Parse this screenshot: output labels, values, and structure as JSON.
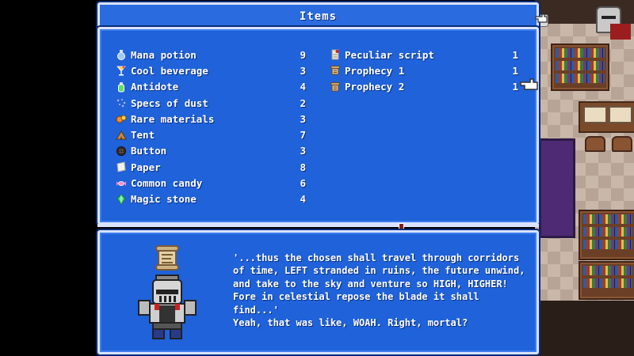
{
  "window": {
    "title": "Items"
  },
  "items_left": [
    {
      "name": "Mana potion",
      "qty": "9",
      "icon": "mana-potion-icon",
      "color": "#9fc6ff"
    },
    {
      "name": "Cool beverage",
      "qty": "3",
      "icon": "cocktail-icon",
      "color": "#ffd24a"
    },
    {
      "name": "Antidote",
      "qty": "4",
      "icon": "antidote-icon",
      "color": "#5fe05f"
    },
    {
      "name": "Specs of dust",
      "qty": "2",
      "icon": "dust-icon",
      "color": "#c9b7ff"
    },
    {
      "name": "Rare materials",
      "qty": "3",
      "icon": "materials-icon",
      "color": "#ff8a2a"
    },
    {
      "name": "Tent",
      "qty": "7",
      "icon": "tent-icon",
      "color": "#c58a4a"
    },
    {
      "name": "Button",
      "qty": "3",
      "icon": "button-icon",
      "color": "#3a2a22"
    },
    {
      "name": "Paper",
      "qty": "8",
      "icon": "paper-icon",
      "color": "#f4f1e8"
    },
    {
      "name": "Common candy",
      "qty": "6",
      "icon": "candy-icon",
      "color": "#ff8fd0"
    },
    {
      "name": "Magic stone",
      "qty": "4",
      "icon": "magic-stone-icon",
      "color": "#3fd07a"
    }
  ],
  "items_right": [
    {
      "name": "Peculiar script",
      "qty": "1",
      "icon": "script-icon",
      "color": "#f0e6d0"
    },
    {
      "name": "Prophecy 1",
      "qty": "1",
      "icon": "prophecy-scroll-icon",
      "color": "#d8b98a"
    },
    {
      "name": "Prophecy 2",
      "qty": "1",
      "icon": "prophecy-scroll-icon",
      "color": "#d8b98a"
    }
  ],
  "selected_item": "Prophecy 2",
  "description": {
    "text": "'...thus the chosen shall travel through corridors of time, LEFT stranded in ruins, the future unwind, and take to the sky and venture so HIGH, HIGHER! Fore in celestial repose the blade it shall find...'\nYeah, that was like, WOAH. Right, mortal?"
  },
  "colors": {
    "panel": "#1f62d9",
    "border": "#d9e3ff",
    "text": "#ffffff"
  }
}
